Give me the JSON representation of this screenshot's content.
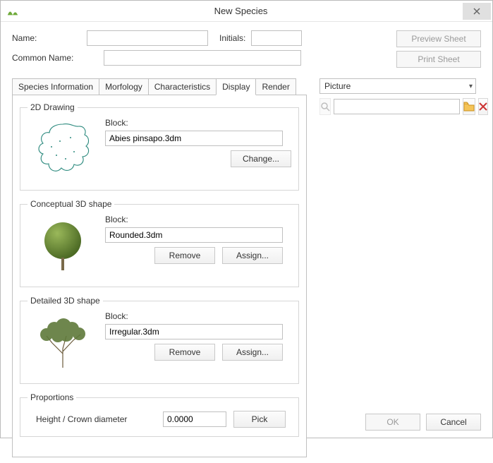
{
  "window": {
    "title": "New Species"
  },
  "form": {
    "name_label": "Name:",
    "name_value": "",
    "initials_label": "Initials:",
    "initials_value": "",
    "common_label": "Common Name:",
    "common_value": ""
  },
  "buttons": {
    "preview_sheet": "Preview Sheet",
    "print_sheet": "Print Sheet",
    "ok": "OK",
    "cancel": "Cancel"
  },
  "tabs": {
    "species_info": "Species Information",
    "morfology": "Morfology",
    "characteristics": "Characteristics",
    "display": "Display",
    "render": "Render",
    "active": "display"
  },
  "display_tab": {
    "drawing2d": {
      "legend": "2D Drawing",
      "block_label": "Block:",
      "block_value": "Abies pinsapo.3dm",
      "change": "Change..."
    },
    "conceptual": {
      "legend": "Conceptual 3D shape",
      "block_label": "Block:",
      "block_value": "Rounded.3dm",
      "remove": "Remove",
      "assign": "Assign..."
    },
    "detailed": {
      "legend": "Detailed 3D shape",
      "block_label": "Block:",
      "block_value": "Irregular.3dm",
      "remove": "Remove",
      "assign": "Assign..."
    },
    "proportions": {
      "legend": "Proportions",
      "label": "Height / Crown diameter",
      "value": "0.0000",
      "pick": "Pick"
    }
  },
  "picture": {
    "combo_label": "Picture",
    "path_value": ""
  }
}
